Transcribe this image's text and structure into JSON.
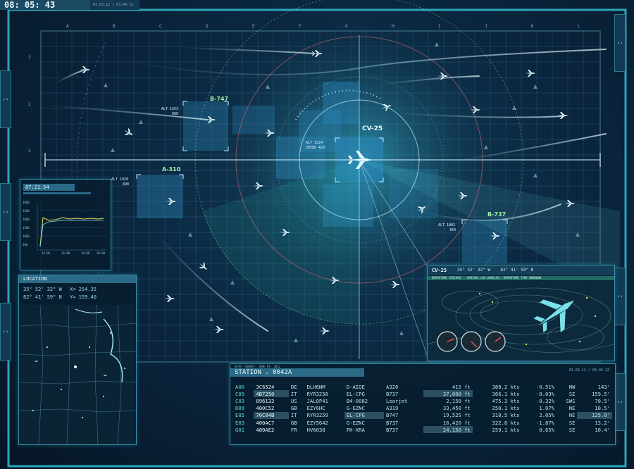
{
  "header": {
    "clock": "08: 05: 43",
    "dates": "01.03.12 / 03.04.12"
  },
  "grid": {
    "columns": [
      "A",
      "B",
      "C",
      "D",
      "E",
      "F",
      "G",
      "H",
      "I",
      "J",
      "K",
      "L"
    ],
    "rows": [
      "1",
      "2",
      "3"
    ]
  },
  "aircraft": [
    {
      "label": "B-747",
      "alt": "ALT 1253",
      "speed": "600"
    },
    {
      "label": "CV-25",
      "alt": "ALT 1524",
      "speed": "SPEED 420"
    },
    {
      "label": "A-310",
      "alt": "ALT 1028",
      "speed": "490"
    },
    {
      "label": "B-737",
      "alt": "ALT 1002",
      "speed": "350"
    }
  ],
  "graph_panel": {
    "time": "07:21:54",
    "y_ticks": [
      "3000",
      "2500",
      "2000",
      "1500",
      "1000",
      "500"
    ],
    "x_ticks": [
      "14:00",
      "16:00",
      "18:00",
      "20:00"
    ]
  },
  "location_panel": {
    "title": "LOCATION",
    "lat": "35° 52' 32\" W",
    "lon": "82° 41' 59\" N",
    "x": "X= 254.35",
    "y": "Y= 159.40"
  },
  "cv_panel": {
    "title": "CV-25",
    "coords": "35° 52' 32\" W    82° 41' 59\" N",
    "sub": [
      "DEPARTURE CHICAGO",
      "ARRIVAL LOS ANGELES",
      "DEPARTURE TIME UNKNOWN"
    ]
  },
  "station": {
    "date": "DATE: SUNDAY, JUNE 07, 2012",
    "title": "STATION . 0042A",
    "range": "01.03.12 / 03.04.12",
    "rows": [
      [
        "A06",
        "3C6524",
        "DE",
        "DLH6NM",
        "D-AIQE",
        "A320",
        "415 ft",
        "380.2 kts",
        "-0.51%",
        "NW",
        "143'"
      ],
      [
        "C09",
        "4B7250",
        "IT",
        "RYR3258",
        "EL-CPG",
        "B737",
        "37,000 ft",
        "366.1 kts",
        "-0.03%",
        "SE",
        "159.5'"
      ],
      [
        "C03",
        "896133",
        "US",
        "JAL0P41",
        "B4-0082",
        "Learjet",
        "2,150 ft",
        "475.3 kts",
        "-0.32%",
        "SWS",
        "70.5'"
      ],
      [
        "D09",
        "400C52",
        "GB",
        "EZY6HC",
        "G-EZNC",
        "A319",
        "33,450 ft",
        "250.1 kts",
        "1.07%",
        "NE",
        "10.5'"
      ],
      [
        "E05",
        "70C04B",
        "IT",
        "RYR3259",
        "EL-CPG",
        "B747",
        "19,525 ft",
        "310.5 kts",
        "2.05%",
        "NE",
        "125.8'"
      ],
      [
        "E03",
        "400AC7",
        "GB",
        "EZY5642",
        "G-EZNC",
        "B737",
        "16,420 ft",
        "322.8 kts",
        "-1.87%",
        "SE",
        "13.2'"
      ],
      [
        "G01",
        "480AE2",
        "FR",
        "HV6038",
        "PH-XRA",
        "B737",
        "24,150 ft",
        "259.1 kts",
        "0.65%",
        "SE",
        "10.4'"
      ]
    ]
  },
  "side_tabs": [
    "››",
    "››",
    "››",
    "››",
    "››",
    "››"
  ]
}
